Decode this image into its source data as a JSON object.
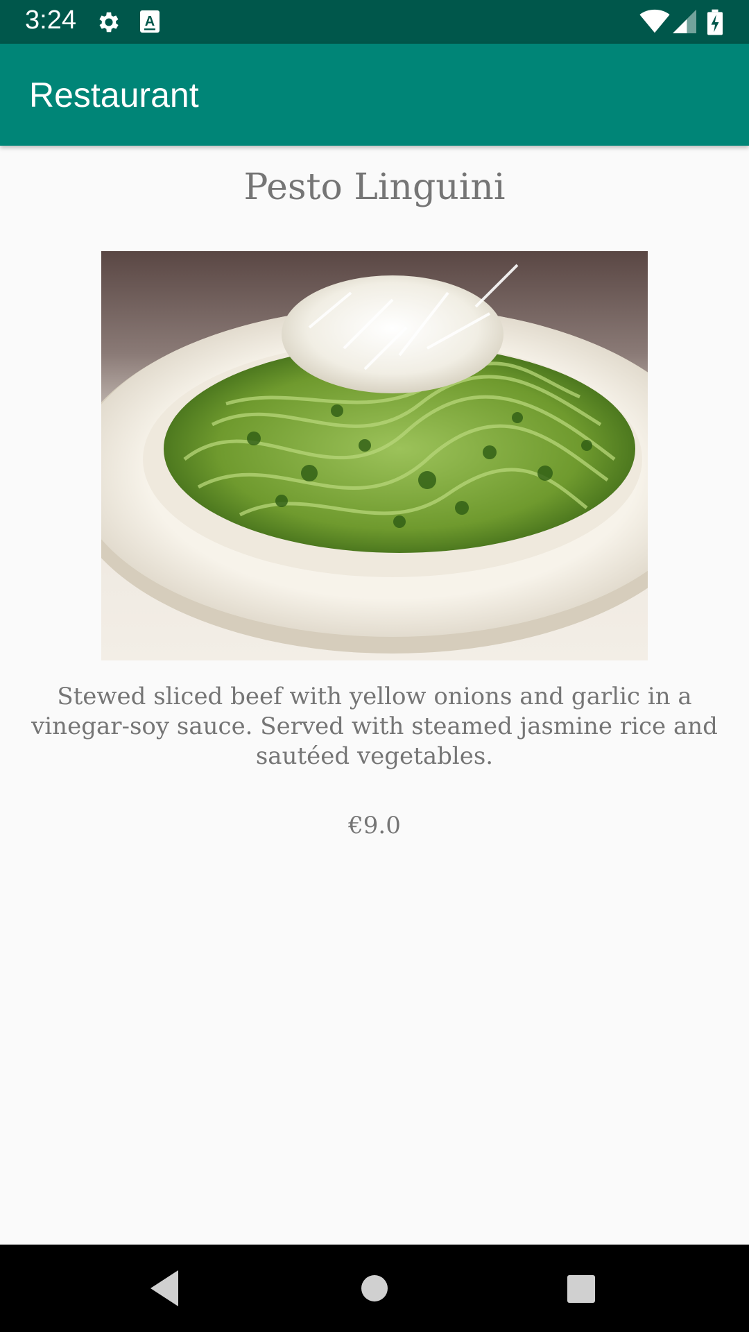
{
  "status_bar": {
    "time": "3:24",
    "icons": [
      "gear-icon",
      "keyboard-a-icon",
      "wifi-icon",
      "signal-icon",
      "battery-charging-icon"
    ]
  },
  "app_bar": {
    "title": "Restaurant"
  },
  "dish": {
    "name": "Pesto Linguini",
    "image": "pesto-linguini-photo",
    "description": "Stewed sliced beef with yellow onions and garlic in a vinegar-soy sauce. Served with steamed jasmine rice and sautéed vegetables.",
    "price": "€9.0"
  },
  "nav_bar": {
    "buttons": [
      "back-icon",
      "home-icon",
      "recents-icon"
    ]
  },
  "colors": {
    "status_bar": "#00574b",
    "app_bar": "#008577",
    "text": "#757575",
    "background": "#fafafa"
  }
}
